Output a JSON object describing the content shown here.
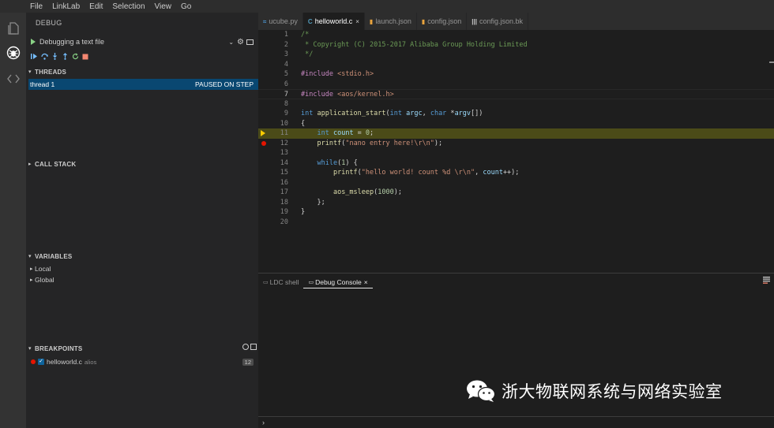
{
  "menu": [
    "File",
    "LinkLab",
    "Edit",
    "Selection",
    "View",
    "Go"
  ],
  "sidebar": {
    "title": "DEBUG",
    "config": "Debugging a text file",
    "threads": {
      "title": "THREADS",
      "rows": [
        {
          "name": "thread 1",
          "status": "PAUSED ON STEP"
        }
      ]
    },
    "callstack": {
      "title": "CALL STACK"
    },
    "variables": {
      "title": "VARIABLES",
      "items": [
        "Local",
        "Global"
      ]
    },
    "breakpoints": {
      "title": "BREAKPOINTS",
      "items": [
        {
          "file": "helloworld.c",
          "path": "alios",
          "line": "12"
        }
      ]
    }
  },
  "tabs": [
    {
      "icon": "python-icon",
      "glyph": "≈",
      "color": "#4d9ad8",
      "label": "ucube.py",
      "active": false
    },
    {
      "icon": "c-file-icon",
      "glyph": "C",
      "color": "#519aba",
      "label": "helloworld.c",
      "active": true
    },
    {
      "icon": "json-icon",
      "glyph": "▮",
      "color": "#e8a33d",
      "label": "launch.json",
      "active": false
    },
    {
      "icon": "json-icon",
      "glyph": "▮",
      "color": "#e8a33d",
      "label": "config.json",
      "active": false
    },
    {
      "icon": "file-lines-icon",
      "glyph": "|||",
      "color": "#cccccc",
      "label": "config.json.bk",
      "active": false
    }
  ],
  "editor": {
    "current_line": 7,
    "highlight_line": 11,
    "breakpoint_line": 12,
    "lines": [
      {
        "n": "1",
        "t": "/*"
      },
      {
        "n": "2",
        "t": " * Copyright (C) 2015-2017 Alibaba Group Holding Limited"
      },
      {
        "n": "3",
        "t": " */"
      },
      {
        "n": "4",
        "t": ""
      },
      {
        "n": "5",
        "t": "#include <stdio.h>"
      },
      {
        "n": "6",
        "t": ""
      },
      {
        "n": "7",
        "t": "#include <aos/kernel.h>"
      },
      {
        "n": "8",
        "t": ""
      },
      {
        "n": "9",
        "t": "int application_start(int argc, char *argv[])"
      },
      {
        "n": "10",
        "t": "{"
      },
      {
        "n": "11",
        "t": "    int count = 0;"
      },
      {
        "n": "12",
        "t": "    printf(\"nano entry here!\\r\\n\");"
      },
      {
        "n": "13",
        "t": ""
      },
      {
        "n": "14",
        "t": "    while(1) {"
      },
      {
        "n": "15",
        "t": "        printf(\"hello world! count %d \\r\\n\", count++);"
      },
      {
        "n": "16",
        "t": ""
      },
      {
        "n": "17",
        "t": "        aos_msleep(1000);"
      },
      {
        "n": "18",
        "t": "    };"
      },
      {
        "n": "19",
        "t": "}"
      },
      {
        "n": "20",
        "t": ""
      }
    ]
  },
  "panel": {
    "tabs": [
      {
        "label": "LDC shell",
        "active": false,
        "close": ""
      },
      {
        "label": "Debug Console",
        "active": true,
        "close": "×"
      }
    ],
    "prompt": "›"
  },
  "watermark": "浙大物联网系统与网络实验室",
  "colors": {
    "accent": "#094771",
    "breakpoint": "#e51400",
    "current_line_highlight": "#4b4b18",
    "debug_arrow": "#ffcc00"
  }
}
